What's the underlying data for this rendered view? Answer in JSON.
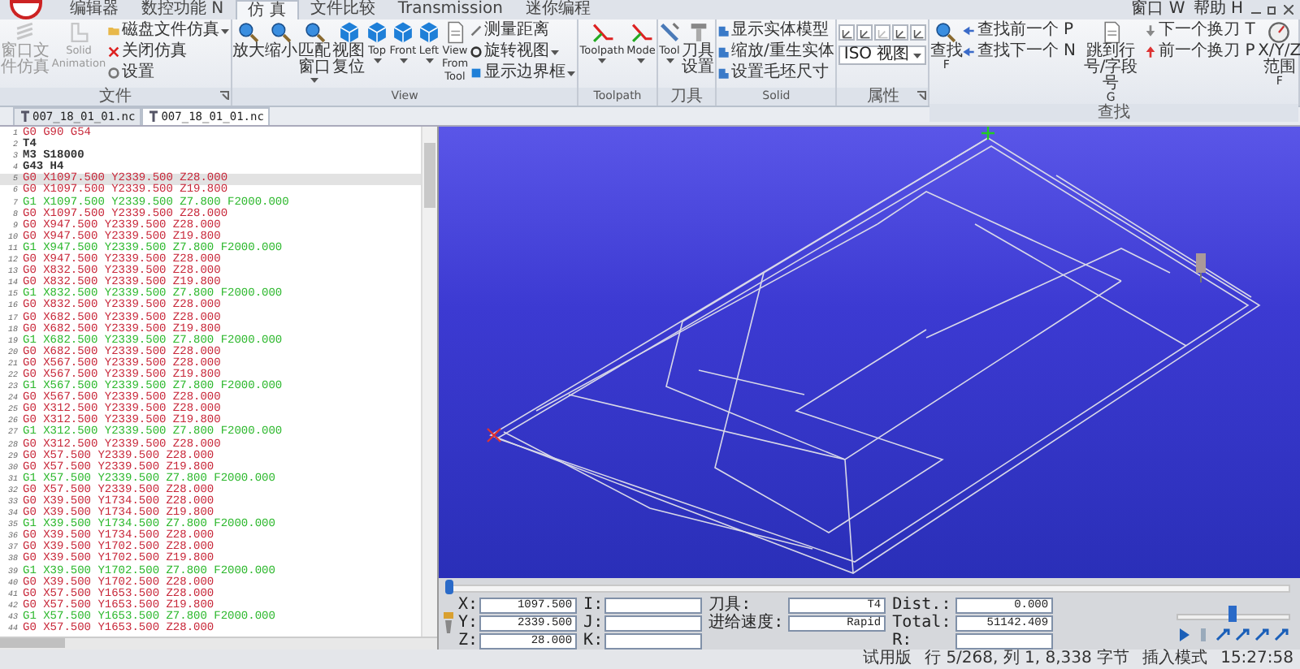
{
  "app_tabs": [
    {
      "label": "编辑器",
      "selected": false
    },
    {
      "label": "数控功能 N",
      "selected": false
    },
    {
      "label": "仿 真",
      "selected": true
    },
    {
      "label": "文件比较",
      "selected": false
    },
    {
      "label": "Transmission",
      "selected": false
    },
    {
      "label": "迷你编程",
      "selected": false
    }
  ],
  "menu": [
    "窗口 W",
    "帮助 H"
  ],
  "ribbon": [
    {
      "title": "文件",
      "launcher": true,
      "items": [
        {
          "kind": "large",
          "label": "窗口文件仿真",
          "disabled": true
        },
        {
          "kind": "large",
          "label": "Solid Animation",
          "disabled": true
        },
        {
          "kind": "stack",
          "items": [
            {
              "label": "磁盘文件仿真",
              "dropdown": true
            },
            {
              "label": "关闭仿真"
            },
            {
              "label": "设置"
            }
          ]
        }
      ]
    },
    {
      "title": "View",
      "items": [
        {
          "kind": "large",
          "label": "放大"
        },
        {
          "kind": "large",
          "label": "缩小"
        },
        {
          "kind": "large",
          "label": "匹配窗口",
          "dropdown": true
        },
        {
          "kind": "large",
          "label": "视图复位"
        },
        {
          "kind": "large",
          "label": "Top",
          "dropdown": true
        },
        {
          "kind": "large",
          "label": "Front",
          "dropdown": true
        },
        {
          "kind": "large",
          "label": "Left",
          "dropdown": true
        },
        {
          "kind": "large",
          "label": "View From Tool"
        },
        {
          "kind": "stack",
          "items": [
            {
              "label": "测量距离"
            },
            {
              "label": "旋转视图",
              "dropdown": true
            },
            {
              "label": "显示边界框",
              "dropdown": true
            }
          ]
        }
      ]
    },
    {
      "title": "Toolpath",
      "items": [
        {
          "kind": "large",
          "label": "Toolpath",
          "dropdown": true
        },
        {
          "kind": "large",
          "label": "Mode",
          "dropdown": true
        }
      ]
    },
    {
      "title": "刀具",
      "items": [
        {
          "kind": "large",
          "label": "Tool",
          "dropdown": true
        },
        {
          "kind": "large",
          "label": "刀具设置"
        }
      ]
    },
    {
      "title": "Solid",
      "items": [
        {
          "kind": "stack",
          "items": [
            {
              "label": "显示实体模型"
            },
            {
              "label": "缩放/重生实体"
            },
            {
              "label": "设置毛坯尺寸"
            }
          ]
        }
      ]
    },
    {
      "title": "属性",
      "launcher": true,
      "items": [
        {
          "kind": "props",
          "select": "ISO 视图"
        }
      ]
    },
    {
      "title": "查找",
      "items": [
        {
          "kind": "large",
          "label": "查找",
          "key": "F"
        },
        {
          "kind": "stack",
          "items": [
            {
              "label": "查找前一个 P"
            },
            {
              "label": "查找下一个 N"
            }
          ]
        },
        {
          "kind": "large",
          "label": "跳到行号/字段号",
          "key": "G"
        },
        {
          "kind": "stack",
          "items": [
            {
              "label": "下一个换刀 T"
            },
            {
              "label": "前一个换刀 P"
            }
          ]
        },
        {
          "kind": "large",
          "label": "X/Y/Z范围",
          "key": "F"
        }
      ]
    }
  ],
  "doc_tabs": [
    {
      "label": "007_18_01_01.nc",
      "selected": false
    },
    {
      "label": "007_18_01_01.nc",
      "selected": true
    }
  ],
  "code_lines": [
    {
      "num": "1",
      "text": "G0 G90 G54",
      "kind": "rapid",
      "selected": false
    },
    {
      "num": "2",
      "text": "T4",
      "kind": "other",
      "selected": false
    },
    {
      "num": "3",
      "text": "M3 S18000",
      "kind": "other",
      "selected": false
    },
    {
      "num": "4",
      "text": "G43 H4",
      "kind": "other",
      "selected": false
    },
    {
      "num": "5",
      "text": "G0 X1097.500 Y2339.500 Z28.000",
      "kind": "rapid",
      "selected": true
    },
    {
      "num": "6",
      "text": "G0 X1097.500 Y2339.500 Z19.800",
      "kind": "rapid",
      "selected": false
    },
    {
      "num": "7",
      "text": "G1 X1097.500 Y2339.500 Z7.800 F2000.000",
      "kind": "feed",
      "selected": false
    },
    {
      "num": "8",
      "text": "G0 X1097.500 Y2339.500 Z28.000",
      "kind": "rapid",
      "selected": false
    },
    {
      "num": "9",
      "text": "G0 X947.500 Y2339.500 Z28.000",
      "kind": "rapid",
      "selected": false
    },
    {
      "num": "10",
      "text": "G0 X947.500 Y2339.500 Z19.800",
      "kind": "rapid",
      "selected": false
    },
    {
      "num": "11",
      "text": "G1 X947.500 Y2339.500 Z7.800 F2000.000",
      "kind": "feed",
      "selected": false
    },
    {
      "num": "12",
      "text": "G0 X947.500 Y2339.500 Z28.000",
      "kind": "rapid",
      "selected": false
    },
    {
      "num": "13",
      "text": "G0 X832.500 Y2339.500 Z28.000",
      "kind": "rapid",
      "selected": false
    },
    {
      "num": "14",
      "text": "G0 X832.500 Y2339.500 Z19.800",
      "kind": "rapid",
      "selected": false
    },
    {
      "num": "15",
      "text": "G1 X832.500 Y2339.500 Z7.800 F2000.000",
      "kind": "feed",
      "selected": false
    },
    {
      "num": "16",
      "text": "G0 X832.500 Y2339.500 Z28.000",
      "kind": "rapid",
      "selected": false
    },
    {
      "num": "17",
      "text": "G0 X682.500 Y2339.500 Z28.000",
      "kind": "rapid",
      "selected": false
    },
    {
      "num": "18",
      "text": "G0 X682.500 Y2339.500 Z19.800",
      "kind": "rapid",
      "selected": false
    },
    {
      "num": "19",
      "text": "G1 X682.500 Y2339.500 Z7.800 F2000.000",
      "kind": "feed",
      "selected": false
    },
    {
      "num": "20",
      "text": "G0 X682.500 Y2339.500 Z28.000",
      "kind": "rapid",
      "selected": false
    },
    {
      "num": "21",
      "text": "G0 X567.500 Y2339.500 Z28.000",
      "kind": "rapid",
      "selected": false
    },
    {
      "num": "22",
      "text": "G0 X567.500 Y2339.500 Z19.800",
      "kind": "rapid",
      "selected": false
    },
    {
      "num": "23",
      "text": "G1 X567.500 Y2339.500 Z7.800 F2000.000",
      "kind": "feed",
      "selected": false
    },
    {
      "num": "24",
      "text": "G0 X567.500 Y2339.500 Z28.000",
      "kind": "rapid",
      "selected": false
    },
    {
      "num": "25",
      "text": "G0 X312.500 Y2339.500 Z28.000",
      "kind": "rapid",
      "selected": false
    },
    {
      "num": "26",
      "text": "G0 X312.500 Y2339.500 Z19.800",
      "kind": "rapid",
      "selected": false
    },
    {
      "num": "27",
      "text": "G1 X312.500 Y2339.500 Z7.800 F2000.000",
      "kind": "feed",
      "selected": false
    },
    {
      "num": "28",
      "text": "G0 X312.500 Y2339.500 Z28.000",
      "kind": "rapid",
      "selected": false
    },
    {
      "num": "29",
      "text": "G0 X57.500 Y2339.500 Z28.000",
      "kind": "rapid",
      "selected": false
    },
    {
      "num": "30",
      "text": "G0 X57.500 Y2339.500 Z19.800",
      "kind": "rapid",
      "selected": false
    },
    {
      "num": "31",
      "text": "G1 X57.500 Y2339.500 Z7.800 F2000.000",
      "kind": "feed",
      "selected": false
    },
    {
      "num": "32",
      "text": "G0 X57.500 Y2339.500 Z28.000",
      "kind": "rapid",
      "selected": false
    },
    {
      "num": "33",
      "text": "G0 X39.500 Y1734.500 Z28.000",
      "kind": "rapid",
      "selected": false
    },
    {
      "num": "34",
      "text": "G0 X39.500 Y1734.500 Z19.800",
      "kind": "rapid",
      "selected": false
    },
    {
      "num": "35",
      "text": "G1 X39.500 Y1734.500 Z7.800 F2000.000",
      "kind": "feed",
      "selected": false
    },
    {
      "num": "36",
      "text": "G0 X39.500 Y1734.500 Z28.000",
      "kind": "rapid",
      "selected": false
    },
    {
      "num": "37",
      "text": "G0 X39.500 Y1702.500 Z28.000",
      "kind": "rapid",
      "selected": false
    },
    {
      "num": "38",
      "text": "G0 X39.500 Y1702.500 Z19.800",
      "kind": "rapid",
      "selected": false
    },
    {
      "num": "39",
      "text": "G1 X39.500 Y1702.500 Z7.800 F2000.000",
      "kind": "feed",
      "selected": false
    },
    {
      "num": "40",
      "text": "G0 X39.500 Y1702.500 Z28.000",
      "kind": "rapid",
      "selected": false
    },
    {
      "num": "41",
      "text": "G0 X57.500 Y1653.500 Z28.000",
      "kind": "rapid",
      "selected": false
    },
    {
      "num": "42",
      "text": "G0 X57.500 Y1653.500 Z19.800",
      "kind": "rapid",
      "selected": false
    },
    {
      "num": "43",
      "text": "G1 X57.500 Y1653.500 Z7.800 F2000.000",
      "kind": "feed",
      "selected": false
    },
    {
      "num": "44",
      "text": "G0 X57.500 Y1653.500 Z28.000",
      "kind": "rapid",
      "selected": false
    }
  ],
  "scrubber": {
    "level": 0.0
  },
  "readout": {
    "columns": [
      [
        {
          "label": "X:",
          "value": "1097.500"
        },
        {
          "label": "Y:",
          "value": "2339.500"
        },
        {
          "label": "Z:",
          "value": "28.000"
        }
      ],
      [
        {
          "label": "I:"
        },
        {
          "label": "J:"
        },
        {
          "label": "K:"
        }
      ],
      [
        {
          "label": "刀具:",
          "value": "T4"
        },
        {
          "label": "进给速度:",
          "value": "Rapid"
        }
      ],
      [
        {
          "label": "Dist.:",
          "value": "0.000"
        },
        {
          "label": "Total:",
          "value": "51142.409"
        },
        {
          "label": "R:"
        }
      ]
    ]
  },
  "speed": {
    "level": 0.49
  },
  "status_bar": [
    "试用版",
    "行 5/268, 列 1, 8,338 字节",
    "插入模式",
    "15:27:58"
  ]
}
